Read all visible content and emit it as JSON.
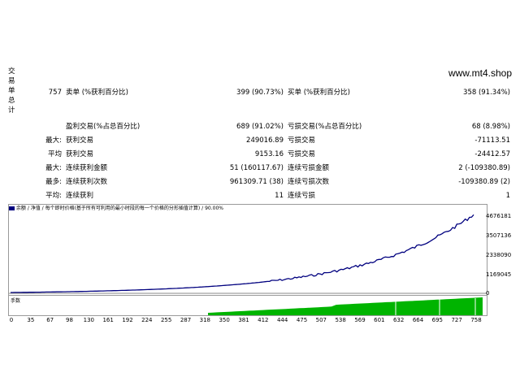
{
  "site": "www.mt4.shop",
  "side_label": [
    "交",
    "易",
    "单",
    "总",
    "计"
  ],
  "stats": {
    "total_trades": "757",
    "short_label": "卖单 (%获利百分比)",
    "short_value": "399 (90.73%)",
    "long_label": "买单 (%获利百分比)",
    "long_value": "358 (91.34%)",
    "profit_trades_label": "盈利交易(%占总百分比)",
    "profit_trades_value": "689 (91.02%)",
    "loss_trades_label": "亏损交易(%占总百分比)",
    "loss_trades_value": "68 (8.98%)",
    "max_label": "最大:",
    "max_profit_label": "获利交易",
    "max_profit_value": "249016.89",
    "max_loss_label": "亏损交易",
    "max_loss_value": "-71113.51",
    "avg_label": "平均",
    "avg_profit_label": "获利交易",
    "avg_profit_value": "9153.16",
    "avg_loss_label": "亏损交易",
    "avg_loss_value": "-24412.57",
    "max2_label": "最大:",
    "cons_win_amt_label": "连续获利金额",
    "cons_win_amt_value": "51 (160117.67)",
    "cons_loss_amt_label": "连续亏损金额",
    "cons_loss_amt_value": "2 (-109380.89)",
    "most_label": "最多:",
    "cons_win_cnt_label": "连续获利次数",
    "cons_win_cnt_value": "961309.71 (38)",
    "cons_loss_cnt_label": "连续亏损次数",
    "cons_loss_cnt_value": "-109380.89 (2)",
    "avg2_label": "平均:",
    "cons_win_label": "连续获利",
    "cons_win_value": "11",
    "cons_loss_label": "连续亏损",
    "cons_loss_value": "1"
  },
  "chart": {
    "legend": "余额 / 净值 / 每个即时价格(基于所有可利用的最小时段的每一个价格的分形插值计算) / 90.00%",
    "volume_label": "手数",
    "line_color": "#00007f",
    "volume_color": "#00b400",
    "y_ticks": [
      "4676181",
      "3507136",
      "2338090",
      "1169045",
      "0"
    ],
    "x_ticks": [
      "0",
      "35",
      "67",
      "98",
      "130",
      "161",
      "192",
      "224",
      "255",
      "287",
      "318",
      "350",
      "381",
      "412",
      "444",
      "475",
      "507",
      "538",
      "569",
      "601",
      "632",
      "664",
      "695",
      "727",
      "758"
    ]
  }
}
